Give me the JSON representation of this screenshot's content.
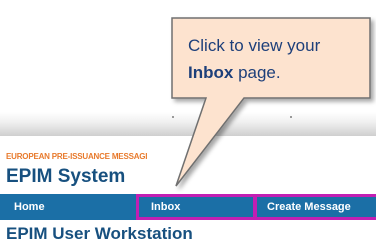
{
  "callout": {
    "line1": "Click to view your",
    "emphasis": "Inbox",
    "line2_rest": " page."
  },
  "header": {
    "tagline": "EUROPEAN PRE-ISSUANCE MESSAGI",
    "system_title": "EPIM System"
  },
  "nav": {
    "home": "Home",
    "inbox": "Inbox",
    "create_message": "Create Message"
  },
  "page": {
    "title": "EPIM User Workstation"
  },
  "colors": {
    "nav_background": "#1b6fa6",
    "highlight_border": "#c21fb3",
    "title": "#17507f",
    "tagline": "#e87a2c",
    "callout_fill": "#fde3cf"
  }
}
